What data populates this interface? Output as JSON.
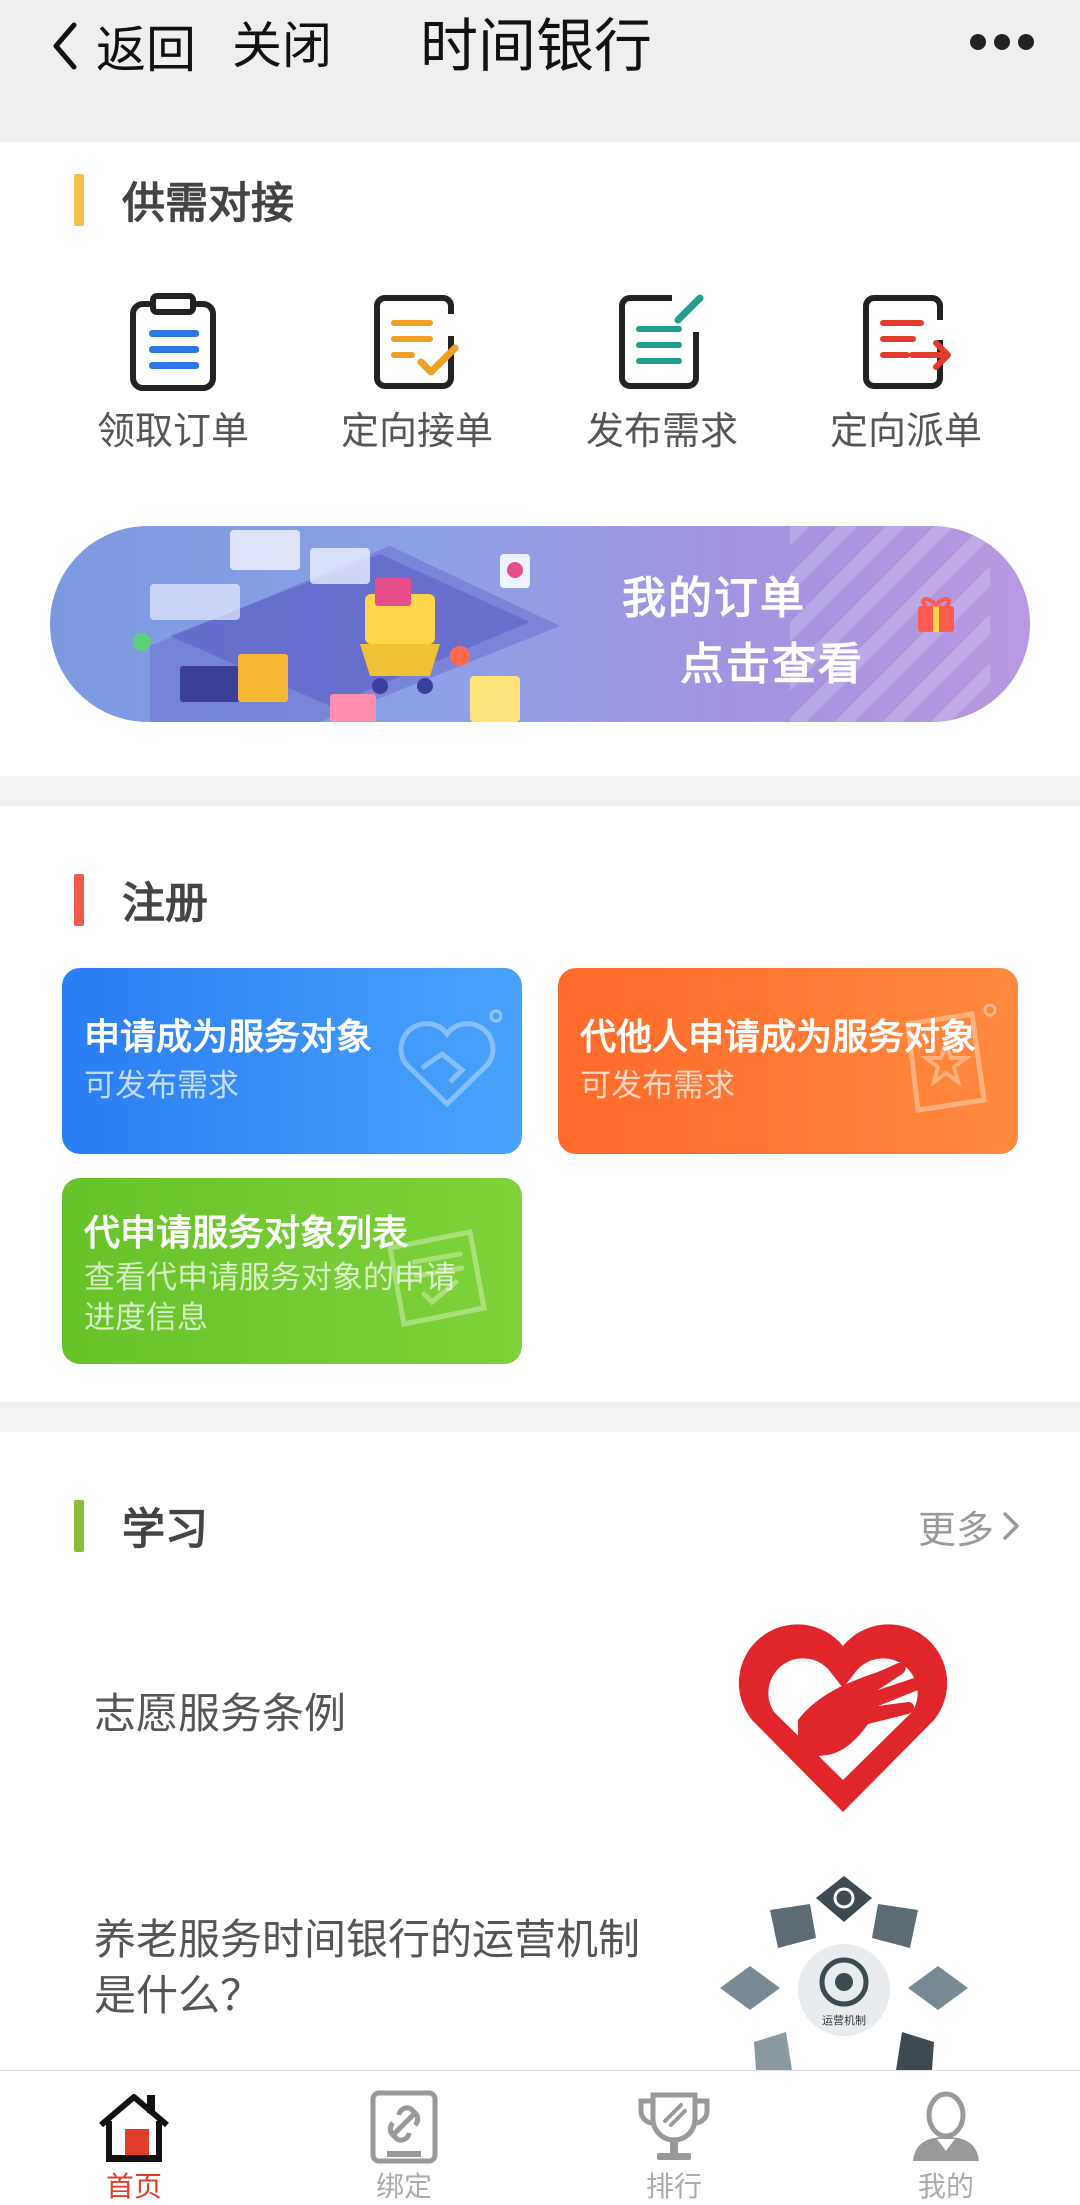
{
  "nav": {
    "back_label": "返回",
    "close_label": "关闭",
    "title": "时间银行"
  },
  "supply": {
    "title": "供需对接",
    "items": [
      {
        "label": "领取订单",
        "icon": "clipboard-icon"
      },
      {
        "label": "定向接单",
        "icon": "checklist-icon"
      },
      {
        "label": "发布需求",
        "icon": "edit-document-icon"
      },
      {
        "label": "定向派单",
        "icon": "dispatch-document-icon"
      }
    ],
    "banner": {
      "line1": "我的订单",
      "line2": "点击查看"
    }
  },
  "register": {
    "title": "注册",
    "cards": [
      {
        "title": "申请成为服务对象",
        "subtitle": "可发布需求",
        "color": "#2f86f6"
      },
      {
        "title": "代他人申请成为服务对象",
        "subtitle": "可发布需求",
        "color": "#ff6e2e"
      },
      {
        "title": "代申请服务对象列表",
        "subtitle_line1": "查看代申请服务对象的申请",
        "subtitle_line2": "进度信息",
        "color": "#6dc72d"
      }
    ]
  },
  "study": {
    "title": "学习",
    "more": "更多",
    "articles": [
      {
        "title": "志愿服务条例",
        "image_icon": "volunteer-heart-hand-icon"
      },
      {
        "title_line1": "养老服务时间银行的运营机制",
        "title_line2": "是什么？",
        "image_icon": "mechanism-diagram-icon",
        "image_caption": "运营机制"
      }
    ]
  },
  "tabbar": {
    "tabs": [
      {
        "label": "首页",
        "icon": "home-icon"
      },
      {
        "label": "绑定",
        "icon": "link-icon"
      },
      {
        "label": "排行",
        "icon": "trophy-icon"
      },
      {
        "label": "我的",
        "icon": "user-icon"
      }
    ]
  },
  "colors": {
    "accent_red": "#e23d2c",
    "bar_yellow": "#f5c04a",
    "bar_red": "#ef5b4c",
    "bar_green": "#8cbc3e"
  }
}
